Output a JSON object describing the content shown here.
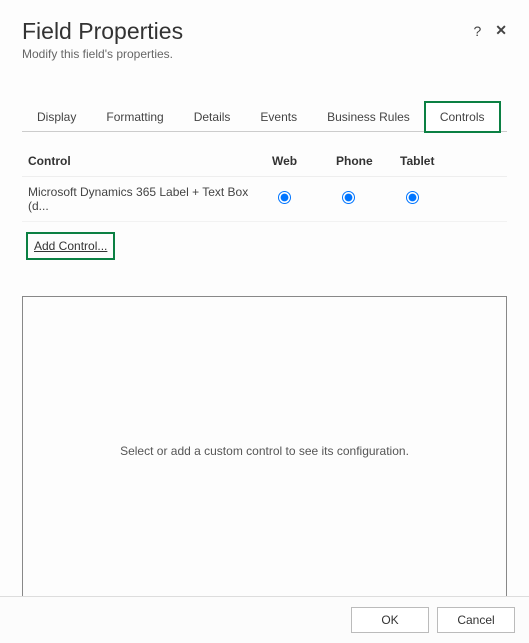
{
  "header": {
    "title": "Field Properties",
    "subtitle": "Modify this field's properties.",
    "help": "?",
    "close": "✕"
  },
  "tabs": {
    "display": "Display",
    "formatting": "Formatting",
    "details": "Details",
    "events": "Events",
    "business_rules": "Business Rules",
    "controls": "Controls"
  },
  "table": {
    "headers": {
      "control": "Control",
      "web": "Web",
      "phone": "Phone",
      "tablet": "Tablet"
    },
    "rows": [
      {
        "control": "Microsoft Dynamics 365 Label + Text Box (d..."
      }
    ],
    "add_control": "Add Control..."
  },
  "config": {
    "placeholder": "Select or add a custom control to see its configuration."
  },
  "footer": {
    "ok": "OK",
    "cancel": "Cancel"
  }
}
